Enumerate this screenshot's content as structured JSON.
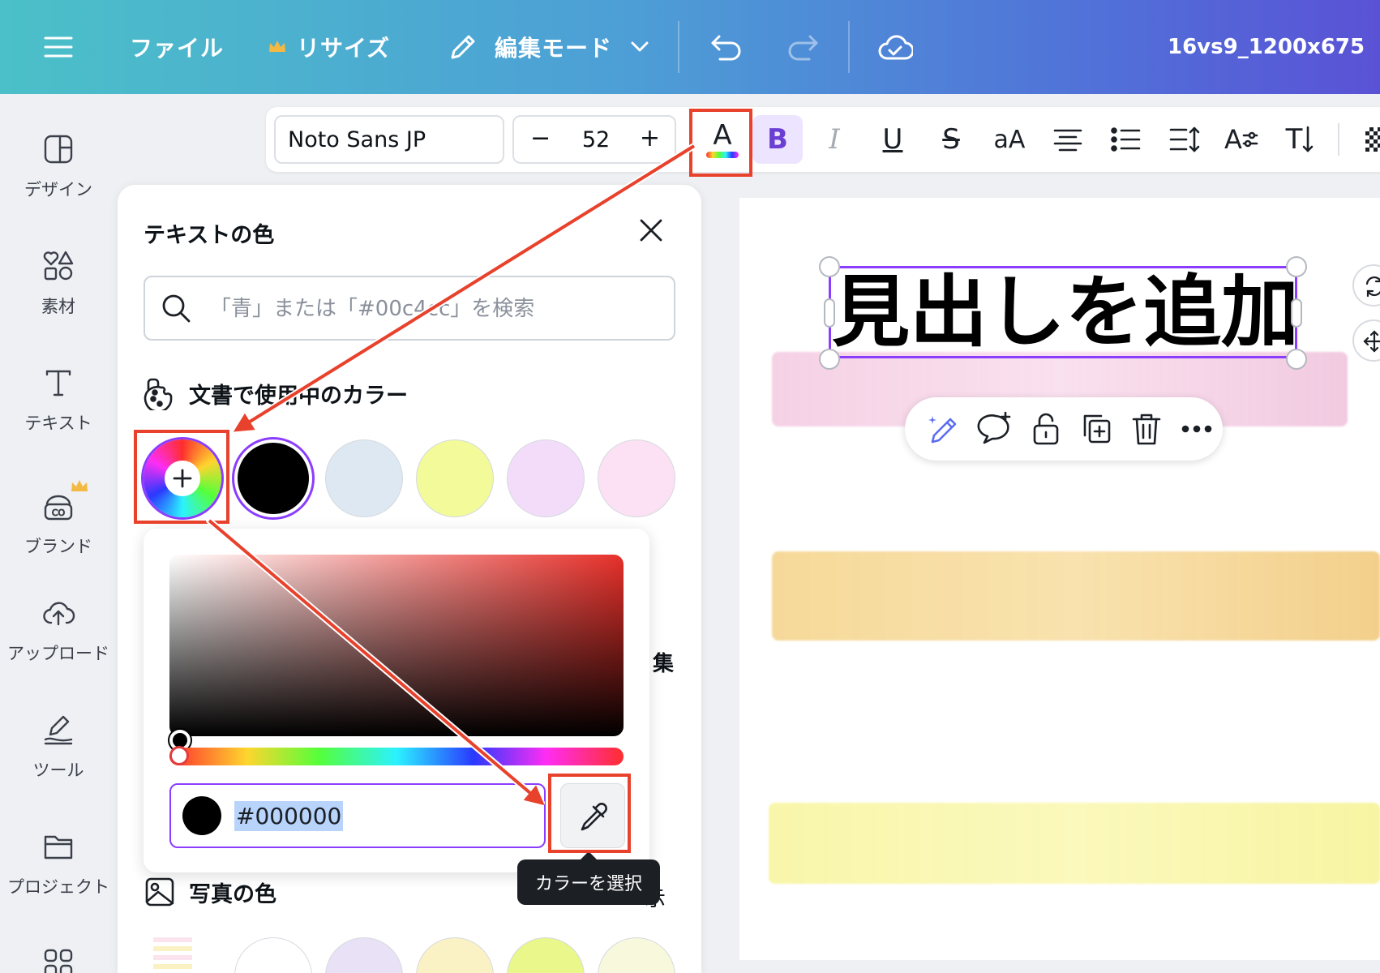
{
  "topbar": {
    "file": "ファイル",
    "resize": "リサイズ",
    "mode": "編集モード",
    "doc_name": "16vs9_1200x675"
  },
  "rail": [
    {
      "label": "デザイン",
      "icon": "layout-icon"
    },
    {
      "label": "素材",
      "icon": "elements-icon"
    },
    {
      "label": "テキスト",
      "icon": "text-icon"
    },
    {
      "label": "ブランド",
      "icon": "brand-icon"
    },
    {
      "label": "アップロード",
      "icon": "cloud-upload-icon"
    },
    {
      "label": "ツール",
      "icon": "draw-icon"
    },
    {
      "label": "プロジェクト",
      "icon": "folder-icon"
    }
  ],
  "toolbar": {
    "font": "Noto Sans JP",
    "size": "52",
    "minus": "−",
    "plus": "+",
    "text_color_glyph": "A",
    "bold": "B",
    "italic": "I",
    "underline": "U",
    "strike": "S",
    "case": "aA",
    "effects": "A",
    "vertical": "T"
  },
  "panel": {
    "title": "テキストの色",
    "search_placeholder": "「青」または「#00c4cc」を検索",
    "doc_colors_heading": "文書で使用中のカラー",
    "photo_colors_heading": "写真の色",
    "collapsed_fragment": "集",
    "collapsed_fragment2": "示"
  },
  "doc_colors": [
    "#000000",
    "#dde8f3",
    "#f3fa9a",
    "#f2dcfa",
    "#fbe1f3"
  ],
  "photo_colors": [
    "#ffffff",
    "#e9e2f6",
    "#faf2c5",
    "#eaf78a",
    "#f8f8dc"
  ],
  "picker": {
    "hex": "#000000",
    "eyedropper_tooltip": "カラーを選択"
  },
  "canvas": {
    "heading": "見出しを追加"
  },
  "colors": {
    "accent": "#8b3dff",
    "annotation": "#e8412c"
  }
}
